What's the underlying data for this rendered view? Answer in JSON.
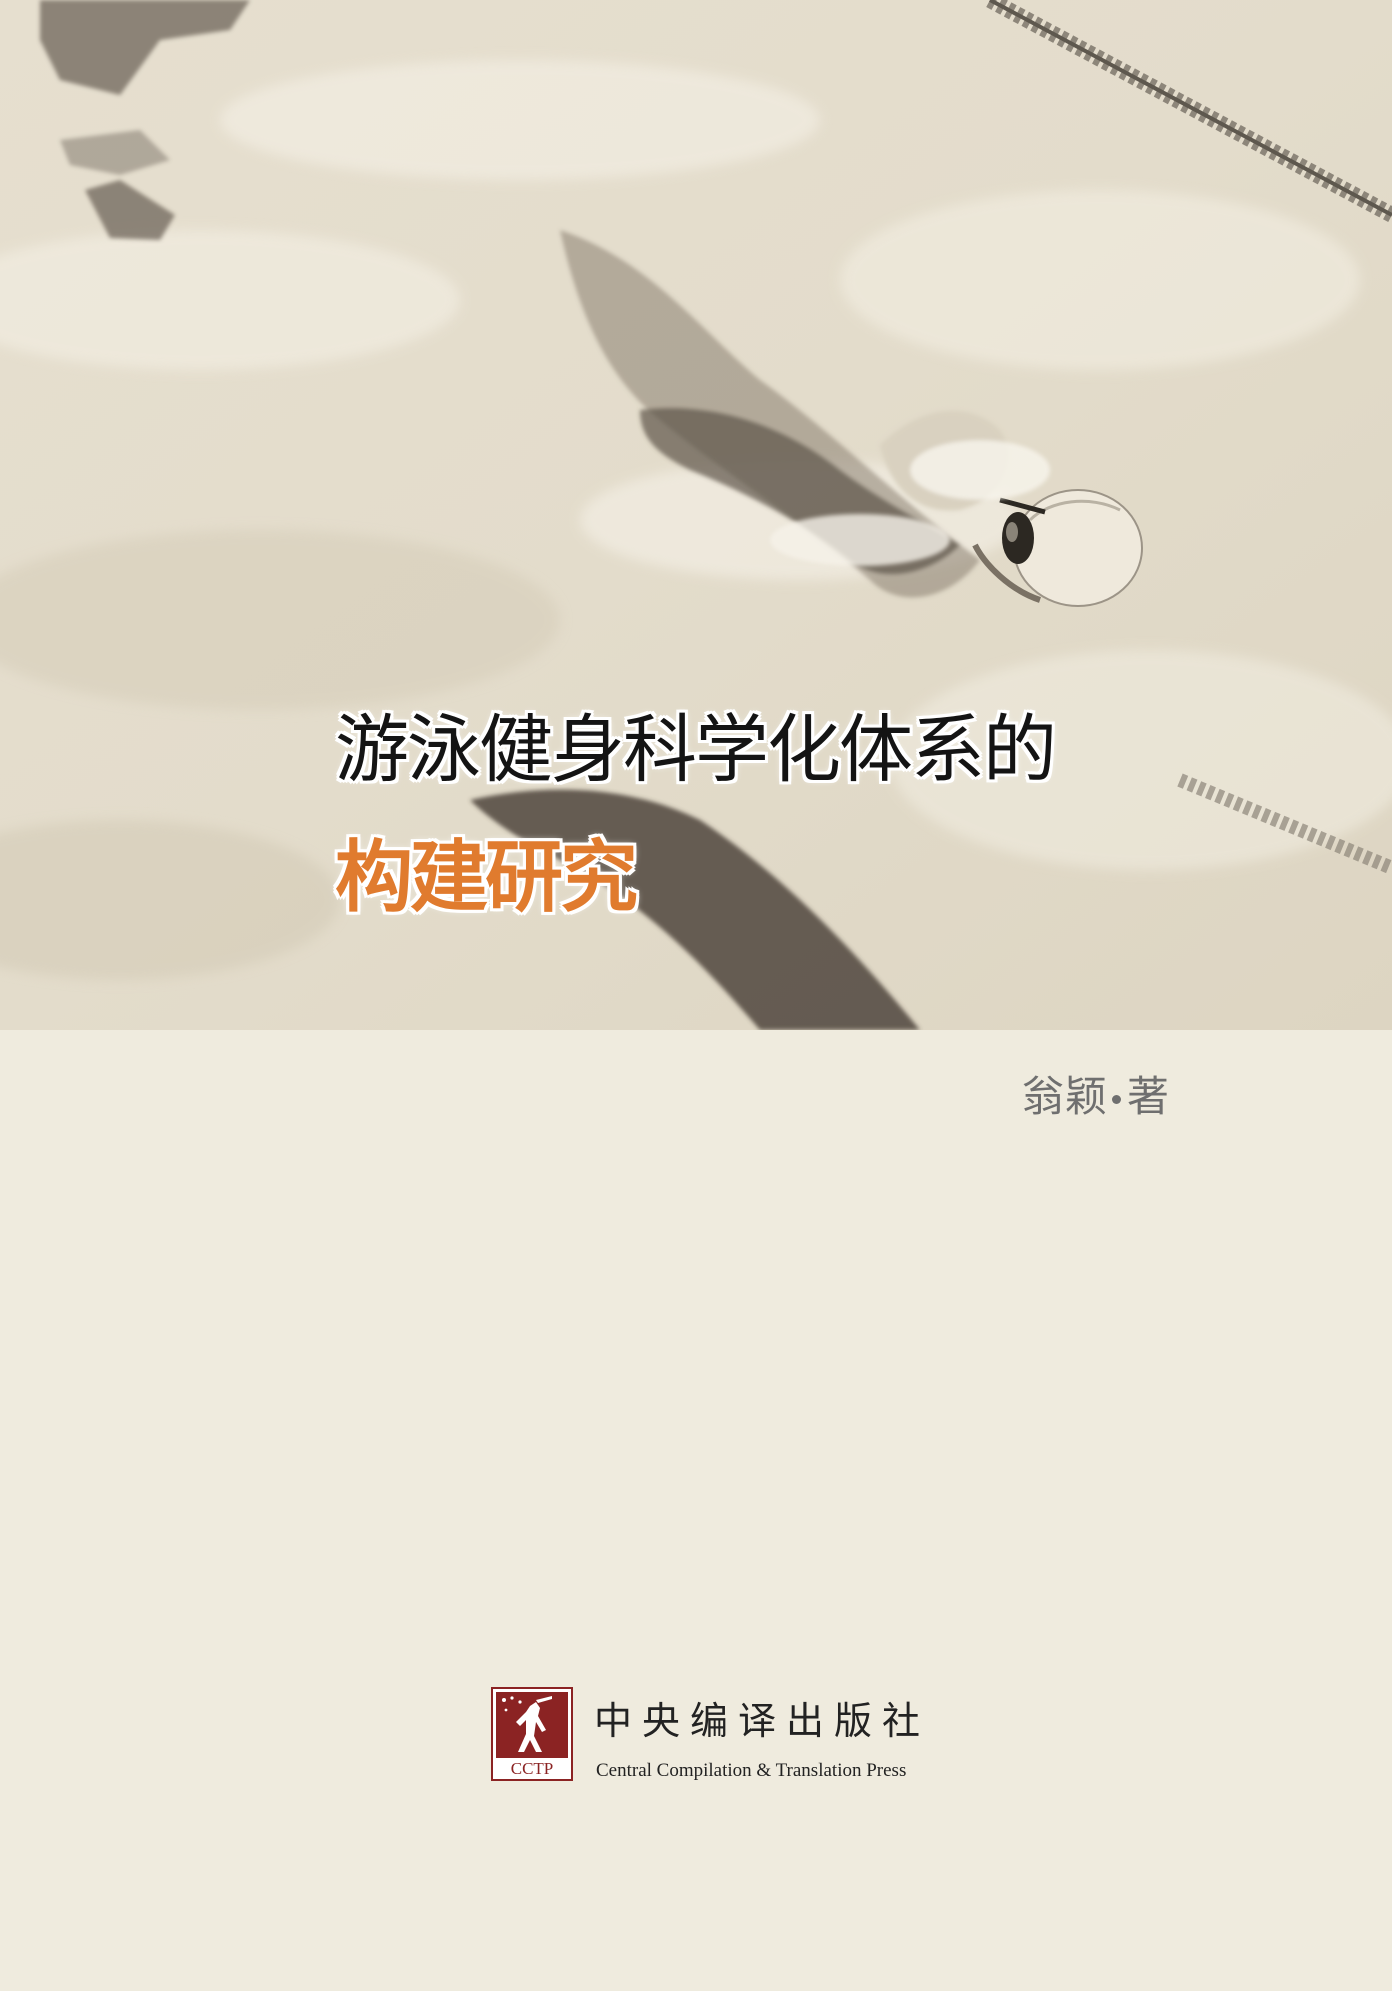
{
  "title": {
    "line1": "游泳健身科学化体系的",
    "line2": "构建研究"
  },
  "author": {
    "name": "翁颖",
    "role": "著"
  },
  "publisher": {
    "logo_text": "CCTP",
    "name_cn": "中央编译出版社",
    "name_en": "Central Compilation & Translation Press"
  },
  "colors": {
    "background": "#efebde",
    "title_accent": "#e07b2e",
    "logo_red": "#8b2323"
  }
}
